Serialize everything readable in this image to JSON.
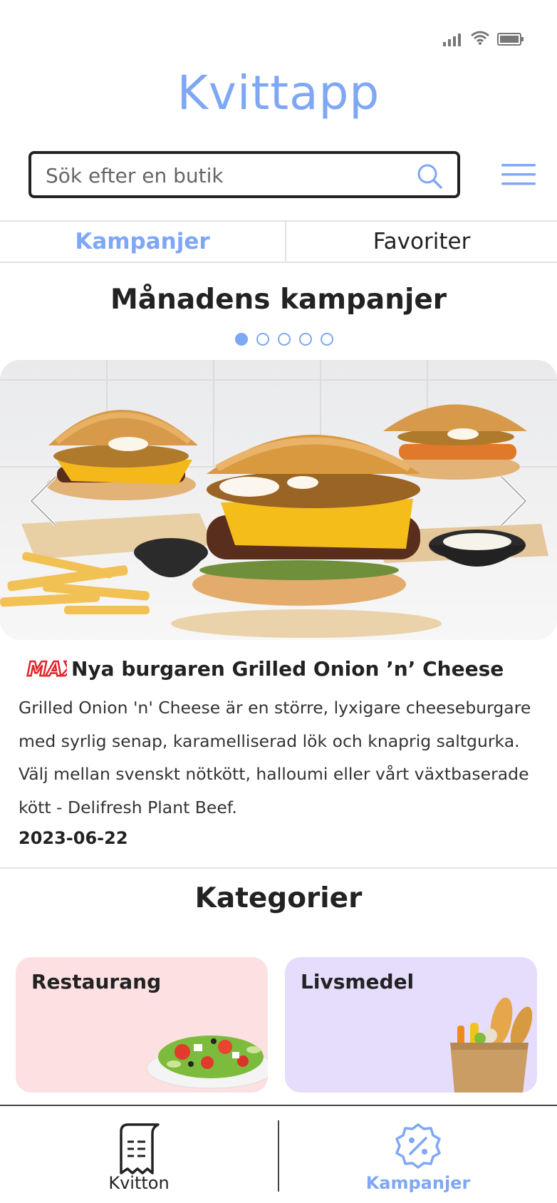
{
  "app": {
    "title": "Kvittapp"
  },
  "status_bar": {
    "icons": [
      "signal-icon",
      "wifi-icon",
      "battery-icon"
    ]
  },
  "search": {
    "placeholder": "Sök efter en butik",
    "value": ""
  },
  "tabs": [
    {
      "label": "Kampanjer",
      "active": true
    },
    {
      "label": "Favoriter",
      "active": false
    }
  ],
  "campaigns": {
    "title": "Månadens kampanjer",
    "carousel": {
      "page_count": 5,
      "active_index": 0
    },
    "featured": {
      "brand_logo": "MAX",
      "title": "Nya burgaren Grilled Onion ’n’ Cheese",
      "description": "Grilled Onion 'n' Cheese är en större, lyxigare cheeseburgare med syrlig senap, karamelliserad lök och knaprig saltgurka. Välj mellan svenskt nötkött, halloumi eller vårt växtbaserade kött - Delifresh Plant Beef.",
      "date": "2023-06-22"
    }
  },
  "categories": {
    "title": "Kategorier",
    "items": [
      {
        "label": "Restaurang",
        "color": "#fde0e1",
        "icon": "salad-image"
      },
      {
        "label": "Livsmedel",
        "color": "#e6dcfb",
        "icon": "grocery-bag-image"
      }
    ]
  },
  "bottom_nav": {
    "items": [
      {
        "label": "Kvitton",
        "icon": "receipt-icon",
        "active": false
      },
      {
        "label": "Kampanjer",
        "icon": "discount-badge-icon",
        "active": true
      }
    ]
  },
  "colors": {
    "accent": "#7ea7f5",
    "text": "#222222",
    "restaurant_card": "#fde0e1",
    "grocery_card": "#e6dcfb",
    "max_red": "#e2242b"
  }
}
